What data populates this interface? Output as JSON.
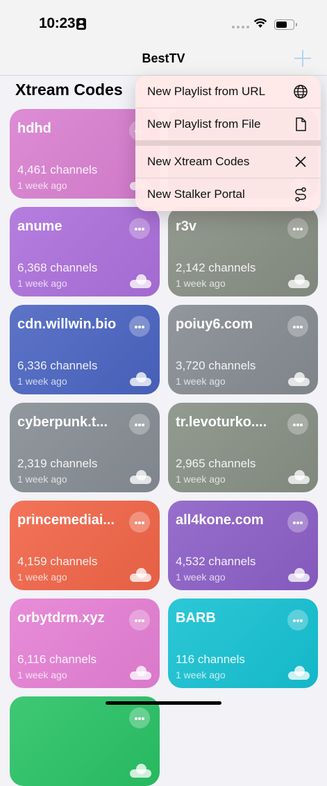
{
  "status": {
    "time": "10:23"
  },
  "nav": {
    "title": "BestTV"
  },
  "section": {
    "title": "Xtream Codes"
  },
  "menu": [
    {
      "label": "New Playlist from URL",
      "icon": "globe-icon"
    },
    {
      "label": "New Playlist from File",
      "icon": "document-icon"
    },
    {
      "label": "New Xtream Codes",
      "icon": "close-icon"
    },
    {
      "label": "New Stalker Portal",
      "icon": "route-icon"
    }
  ],
  "cards": [
    {
      "name": "hdhd",
      "channels": "4,461 channels",
      "updated": "1 week ago",
      "color": "#d97fd0"
    },
    {
      "name": "",
      "channels": "",
      "updated": "",
      "color": "#9aa093"
    },
    {
      "name": "anume",
      "channels": "6,368 channels",
      "updated": "1 week ago",
      "color": "#ac6fdb"
    },
    {
      "name": "r3v",
      "channels": "2,142 channels",
      "updated": "1 week ago",
      "color": "#878e82"
    },
    {
      "name": "cdn.willwin.bio",
      "channels": "6,336 channels",
      "updated": "1 week ago",
      "color": "#4a64c1"
    },
    {
      "name": "poiuy6.com",
      "channels": "3,720 channels",
      "updated": "1 week ago",
      "color": "#868b91"
    },
    {
      "name": "cyberpunk.t...",
      "channels": "2,319 channels",
      "updated": "1 week ago",
      "color": "#858c93"
    },
    {
      "name": "tr.levoturko....",
      "channels": "2,965 channels",
      "updated": "1 week ago",
      "color": "#878f84"
    },
    {
      "name": "princemediai...",
      "channels": "4,159 channels",
      "updated": "1 week ago",
      "color": "#f16447"
    },
    {
      "name": "all4kone.com",
      "channels": "4,532 channels",
      "updated": "1 week ago",
      "color": "#8b5ec6"
    },
    {
      "name": "orbytdrm.xyz",
      "channels": "6,116 channels",
      "updated": "1 week ago",
      "color": "#e57fd4"
    },
    {
      "name": "BARB",
      "channels": "116 channels",
      "updated": "1 week ago",
      "color": "#15c1d2"
    },
    {
      "name": "",
      "channels": "",
      "updated": "",
      "color": "#29c265"
    }
  ]
}
